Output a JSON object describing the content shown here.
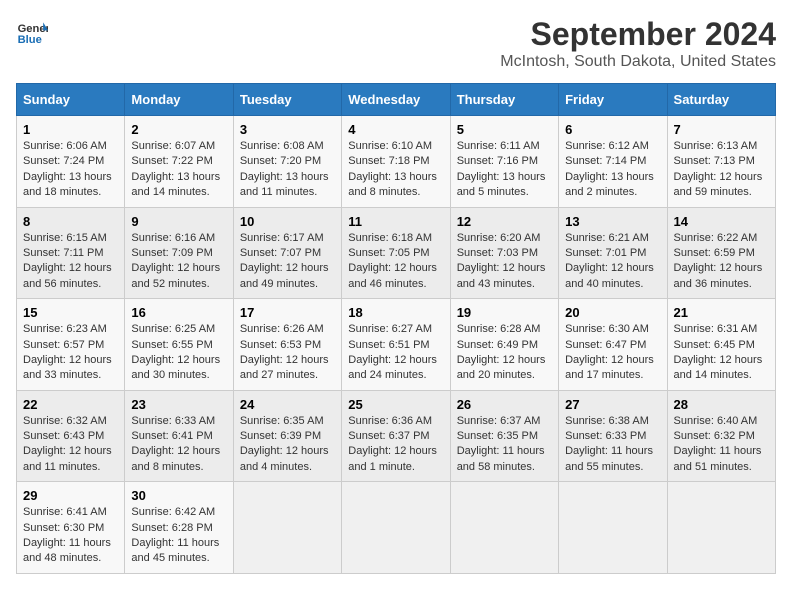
{
  "header": {
    "logo_line1": "General",
    "logo_line2": "Blue",
    "title": "September 2024",
    "subtitle": "McIntosh, South Dakota, United States"
  },
  "days_of_week": [
    "Sunday",
    "Monday",
    "Tuesday",
    "Wednesday",
    "Thursday",
    "Friday",
    "Saturday"
  ],
  "weeks": [
    [
      {
        "day": "1",
        "text": "Sunrise: 6:06 AM\nSunset: 7:24 PM\nDaylight: 13 hours and 18 minutes."
      },
      {
        "day": "2",
        "text": "Sunrise: 6:07 AM\nSunset: 7:22 PM\nDaylight: 13 hours and 14 minutes."
      },
      {
        "day": "3",
        "text": "Sunrise: 6:08 AM\nSunset: 7:20 PM\nDaylight: 13 hours and 11 minutes."
      },
      {
        "day": "4",
        "text": "Sunrise: 6:10 AM\nSunset: 7:18 PM\nDaylight: 13 hours and 8 minutes."
      },
      {
        "day": "5",
        "text": "Sunrise: 6:11 AM\nSunset: 7:16 PM\nDaylight: 13 hours and 5 minutes."
      },
      {
        "day": "6",
        "text": "Sunrise: 6:12 AM\nSunset: 7:14 PM\nDaylight: 13 hours and 2 minutes."
      },
      {
        "day": "7",
        "text": "Sunrise: 6:13 AM\nSunset: 7:13 PM\nDaylight: 12 hours and 59 minutes."
      }
    ],
    [
      {
        "day": "8",
        "text": "Sunrise: 6:15 AM\nSunset: 7:11 PM\nDaylight: 12 hours and 56 minutes."
      },
      {
        "day": "9",
        "text": "Sunrise: 6:16 AM\nSunset: 7:09 PM\nDaylight: 12 hours and 52 minutes."
      },
      {
        "day": "10",
        "text": "Sunrise: 6:17 AM\nSunset: 7:07 PM\nDaylight: 12 hours and 49 minutes."
      },
      {
        "day": "11",
        "text": "Sunrise: 6:18 AM\nSunset: 7:05 PM\nDaylight: 12 hours and 46 minutes."
      },
      {
        "day": "12",
        "text": "Sunrise: 6:20 AM\nSunset: 7:03 PM\nDaylight: 12 hours and 43 minutes."
      },
      {
        "day": "13",
        "text": "Sunrise: 6:21 AM\nSunset: 7:01 PM\nDaylight: 12 hours and 40 minutes."
      },
      {
        "day": "14",
        "text": "Sunrise: 6:22 AM\nSunset: 6:59 PM\nDaylight: 12 hours and 36 minutes."
      }
    ],
    [
      {
        "day": "15",
        "text": "Sunrise: 6:23 AM\nSunset: 6:57 PM\nDaylight: 12 hours and 33 minutes."
      },
      {
        "day": "16",
        "text": "Sunrise: 6:25 AM\nSunset: 6:55 PM\nDaylight: 12 hours and 30 minutes."
      },
      {
        "day": "17",
        "text": "Sunrise: 6:26 AM\nSunset: 6:53 PM\nDaylight: 12 hours and 27 minutes."
      },
      {
        "day": "18",
        "text": "Sunrise: 6:27 AM\nSunset: 6:51 PM\nDaylight: 12 hours and 24 minutes."
      },
      {
        "day": "19",
        "text": "Sunrise: 6:28 AM\nSunset: 6:49 PM\nDaylight: 12 hours and 20 minutes."
      },
      {
        "day": "20",
        "text": "Sunrise: 6:30 AM\nSunset: 6:47 PM\nDaylight: 12 hours and 17 minutes."
      },
      {
        "day": "21",
        "text": "Sunrise: 6:31 AM\nSunset: 6:45 PM\nDaylight: 12 hours and 14 minutes."
      }
    ],
    [
      {
        "day": "22",
        "text": "Sunrise: 6:32 AM\nSunset: 6:43 PM\nDaylight: 12 hours and 11 minutes."
      },
      {
        "day": "23",
        "text": "Sunrise: 6:33 AM\nSunset: 6:41 PM\nDaylight: 12 hours and 8 minutes."
      },
      {
        "day": "24",
        "text": "Sunrise: 6:35 AM\nSunset: 6:39 PM\nDaylight: 12 hours and 4 minutes."
      },
      {
        "day": "25",
        "text": "Sunrise: 6:36 AM\nSunset: 6:37 PM\nDaylight: 12 hours and 1 minute."
      },
      {
        "day": "26",
        "text": "Sunrise: 6:37 AM\nSunset: 6:35 PM\nDaylight: 11 hours and 58 minutes."
      },
      {
        "day": "27",
        "text": "Sunrise: 6:38 AM\nSunset: 6:33 PM\nDaylight: 11 hours and 55 minutes."
      },
      {
        "day": "28",
        "text": "Sunrise: 6:40 AM\nSunset: 6:32 PM\nDaylight: 11 hours and 51 minutes."
      }
    ],
    [
      {
        "day": "29",
        "text": "Sunrise: 6:41 AM\nSunset: 6:30 PM\nDaylight: 11 hours and 48 minutes."
      },
      {
        "day": "30",
        "text": "Sunrise: 6:42 AM\nSunset: 6:28 PM\nDaylight: 11 hours and 45 minutes."
      },
      {
        "day": "",
        "text": ""
      },
      {
        "day": "",
        "text": ""
      },
      {
        "day": "",
        "text": ""
      },
      {
        "day": "",
        "text": ""
      },
      {
        "day": "",
        "text": ""
      }
    ]
  ]
}
